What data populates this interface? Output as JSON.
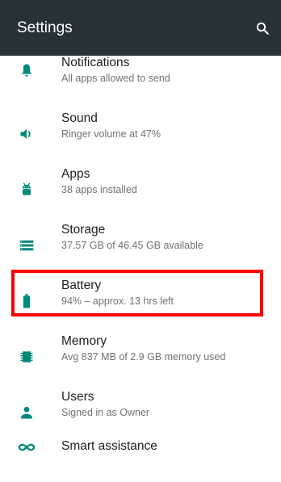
{
  "appbar": {
    "title": "Settings",
    "search_icon": "search-icon",
    "background": "#263238"
  },
  "settings": {
    "accent": "#00897B",
    "items": [
      {
        "title": "Notifications",
        "summary": "All apps allowed to send",
        "icon": "bell-icon"
      },
      {
        "title": "Sound",
        "summary": "Ringer volume at 47%",
        "icon": "volume-icon"
      },
      {
        "title": "Apps",
        "summary": "38 apps installed",
        "icon": "android-icon"
      },
      {
        "title": "Storage",
        "summary": "37.57 GB of 46.45 GB available",
        "icon": "storage-icon"
      },
      {
        "title": "Battery",
        "summary": "94% – approx. 13 hrs left",
        "icon": "battery-icon"
      },
      {
        "title": "Memory",
        "summary": "Avg 837 MB of 2.9 GB memory used",
        "icon": "memory-icon"
      },
      {
        "title": "Users",
        "summary": "Signed in as Owner",
        "icon": "person-icon"
      },
      {
        "title": "Smart assistance",
        "summary": "",
        "icon": "infinity-icon"
      }
    ]
  },
  "annotation": {
    "highlight_color": "#ff0000",
    "highlighted_item": "Battery"
  }
}
